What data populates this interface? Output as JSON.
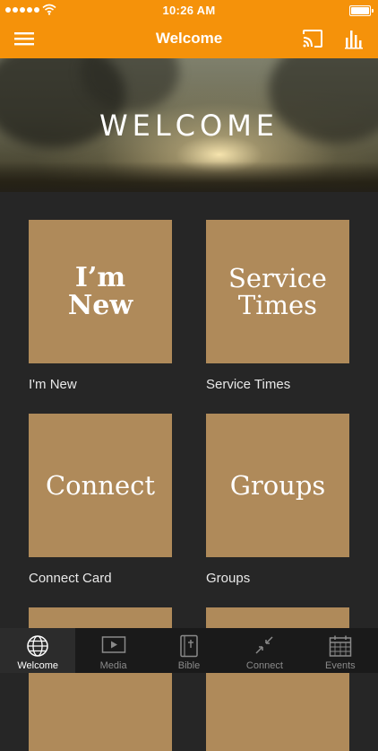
{
  "status": {
    "time": "10:26 AM"
  },
  "nav": {
    "title": "Welcome"
  },
  "hero": {
    "title": "WELCOME"
  },
  "tiles": [
    {
      "text": "I’m\nNew",
      "caption": "I'm New"
    },
    {
      "text": "Service\nTimes",
      "caption": "Service Times"
    },
    {
      "text": "Connect",
      "caption": "Connect Card"
    },
    {
      "text": "Groups",
      "caption": "Groups"
    },
    {
      "text": "",
      "caption": ""
    },
    {
      "text": "",
      "caption": ""
    }
  ],
  "tabs": [
    {
      "label": "Welcome",
      "icon": "globe-icon",
      "active": true
    },
    {
      "label": "Media",
      "icon": "video-icon",
      "active": false
    },
    {
      "label": "Bible",
      "icon": "bible-icon",
      "active": false
    },
    {
      "label": "Connect",
      "icon": "connect-arrows-icon",
      "active": false
    },
    {
      "label": "Events",
      "icon": "calendar-icon",
      "active": false
    }
  ],
  "colors": {
    "accent": "#F5920A",
    "tile": "#AF8A5A",
    "background": "#262626",
    "tabbar": "#1a1a1a"
  }
}
